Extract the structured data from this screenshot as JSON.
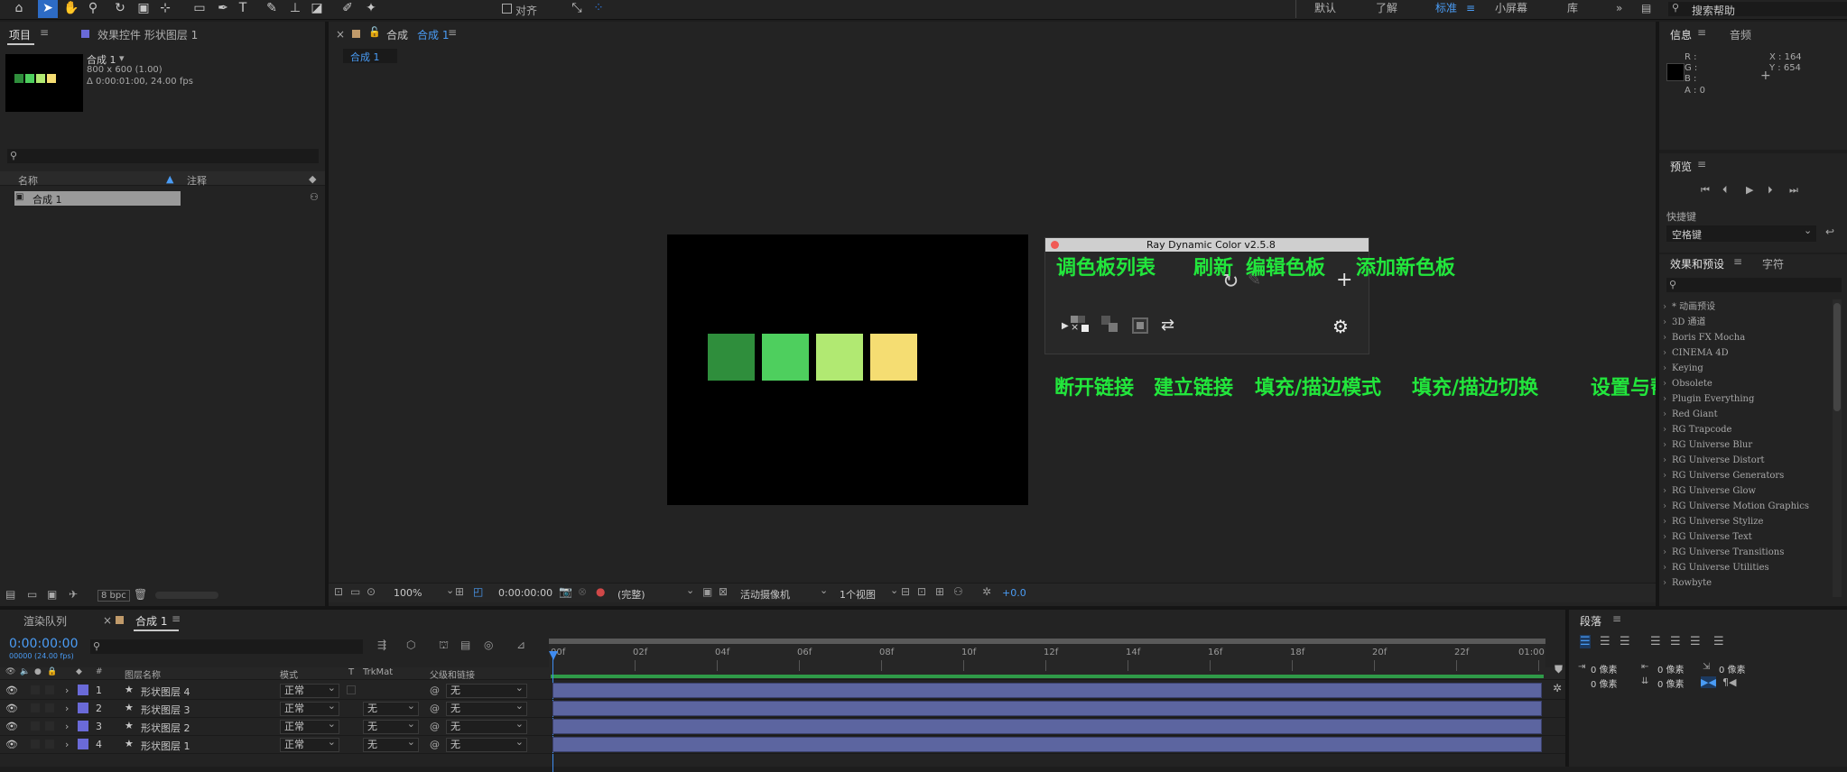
{
  "toolbar": {
    "align_label": "对齐",
    "workspaces": [
      "默认",
      "了解",
      "标准",
      "小屏幕",
      "库"
    ],
    "active_workspace": "标准",
    "search_help": "搜索帮助"
  },
  "project_panel": {
    "tab_project": "项目",
    "tab_effects": "效果控件 形状图层 1",
    "comp_name": "合成 1",
    "comp_info_size": "800 x 600 (1.00)",
    "comp_info_duration": "Δ 0:00:01:00, 24.00 fps",
    "col_name": "名称",
    "col_comment": "注释",
    "item": "合成 1",
    "bpc": "8 bpc"
  },
  "comp_viewer": {
    "tab_label": "合成",
    "tab_name": "合成 1",
    "breadcrumb": "合成 1",
    "zoom": "100%",
    "timecode": "0:00:00:00",
    "resolution": "(完整)",
    "camera": "活动摄像机",
    "views": "1个视图",
    "exposure": "+0.0"
  },
  "palette_swatches": [
    "#2f8e3c",
    "#4ecf5e",
    "#b1e972",
    "#f5dd72"
  ],
  "plugin": {
    "title": "Ray Dynamic Color v2.5.8"
  },
  "annotations": {
    "palette_list": "调色板列表",
    "refresh": "刷新",
    "edit_palette": "编辑色板",
    "add_palette": "添加新色板",
    "unlink": "断开链接",
    "link": "建立链接",
    "fill_stroke_mode": "填充/描边模式",
    "fill_stroke_toggle": "填充/描边切换",
    "settings_help": "设置与帮助"
  },
  "info_panel": {
    "tab_info": "信息",
    "tab_audio": "音频",
    "r": "R :",
    "g": "G :",
    "b": "B :",
    "a": "A : 0",
    "x": "X : 164",
    "y": "Y : 654"
  },
  "preview_panel": {
    "title": "预览",
    "shortcut_label": "快捷键",
    "shortcut_value": "空格键"
  },
  "effects_panel": {
    "tab_effects": "效果和预设",
    "tab_char": "字符",
    "items": [
      "* 动画预设",
      "3D 通道",
      "Boris FX Mocha",
      "CINEMA 4D",
      "Keying",
      "Obsolete",
      "Plugin Everything",
      "Red Giant",
      "RG Trapcode",
      "RG Universe Blur",
      "RG Universe Distort",
      "RG Universe Generators",
      "RG Universe Glow",
      "RG Universe Motion Graphics",
      "RG Universe Stylize",
      "RG Universe Text",
      "RG Universe Transitions",
      "RG Universe Utilities",
      "Rowbyte"
    ]
  },
  "timeline": {
    "tab_render": "渲染队列",
    "tab_comp": "合成 1",
    "timecode": "0:00:00:00",
    "frame_info": "00000 (24.00 fps)",
    "col_layer_name": "图层名称",
    "col_mode": "模式",
    "col_t": "T",
    "col_trkmat": "TrkMat",
    "col_parent": "父级和链接",
    "ticks": [
      "00f",
      "02f",
      "04f",
      "06f",
      "08f",
      "10f",
      "12f",
      "14f",
      "16f",
      "18f",
      "20f",
      "22f",
      "01:00"
    ],
    "layers": [
      {
        "num": "1",
        "name": "形状图层 4",
        "mode": "正常",
        "trkmat": "",
        "parent": "无"
      },
      {
        "num": "2",
        "name": "形状图层 3",
        "mode": "正常",
        "trkmat": "无",
        "parent": "无"
      },
      {
        "num": "3",
        "name": "形状图层 2",
        "mode": "正常",
        "trkmat": "无",
        "parent": "无"
      },
      {
        "num": "4",
        "name": "形状图层 1",
        "mode": "正常",
        "trkmat": "无",
        "parent": "无"
      }
    ]
  },
  "paragraph_panel": {
    "title": "段落",
    "px1": "0 像素",
    "px2": "0 像素",
    "px3": "0 像素",
    "px4": "0 像素",
    "px5": "0 像素"
  }
}
